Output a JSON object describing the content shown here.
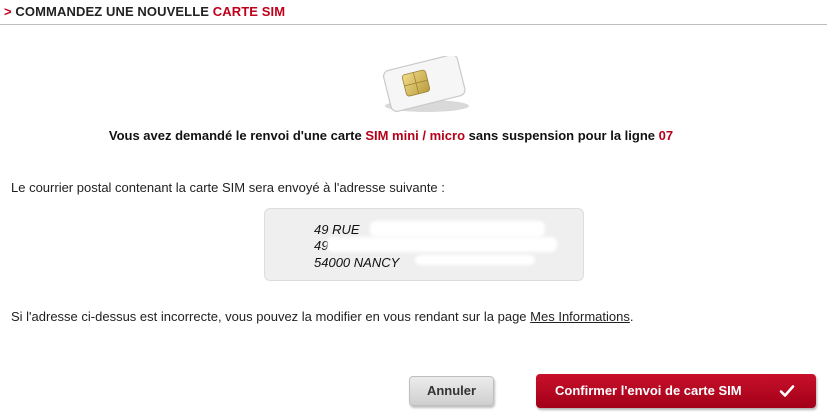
{
  "header": {
    "arrow": ">",
    "title_dark": "COMMANDEZ UNE NOUVELLE",
    "title_accent": "CARTE SIM"
  },
  "headline": {
    "prefix": "Vous avez demandé le renvoi d'une carte",
    "sim_type": "SIM mini / micro",
    "middle": "sans suspension pour la ligne",
    "line_number": "07"
  },
  "intro": "Le courrier postal contenant la carte SIM sera envoyé à l'adresse suivante :",
  "address": {
    "line1": "49 RUE",
    "line2": "49",
    "line3": "54000 NANCY"
  },
  "modify": {
    "text": "Si l'adresse ci-dessus est incorrecte, vous pouvez la modifier en vous rendant sur la page",
    "link": "Mes Informations",
    "end": "."
  },
  "buttons": {
    "cancel": "Annuler",
    "confirm": "Confirmer l'envoi de carte SIM",
    "confirm_icon": "checkmark-icon"
  },
  "colors": {
    "accent": "#c0001a",
    "confirm_bg": "#b5001a"
  }
}
